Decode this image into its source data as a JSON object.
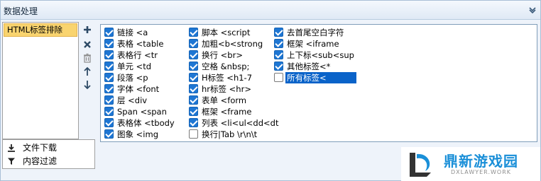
{
  "panel": {
    "title": "数据处理"
  },
  "left_list": {
    "items": [
      "HTML标签排除"
    ]
  },
  "side_tools": [
    "add-icon",
    "delete-icon",
    "trash-icon",
    "move-up-icon",
    "move-down-icon"
  ],
  "bottom_items": [
    {
      "label": "文件下载",
      "icon": "download-icon"
    },
    {
      "label": "内容过滤",
      "icon": "filter-icon"
    }
  ],
  "columns": [
    [
      {
        "label": "链接 <a",
        "checked": true
      },
      {
        "label": "表格 <table",
        "checked": true
      },
      {
        "label": "表格行 <tr",
        "checked": true
      },
      {
        "label": "单元 <td",
        "checked": true
      },
      {
        "label": "段落 <p",
        "checked": true
      },
      {
        "label": "字体 <font",
        "checked": true
      },
      {
        "label": "层 <div",
        "checked": true
      },
      {
        "label": "Span <span",
        "checked": true
      },
      {
        "label": "表格体 <tbody",
        "checked": true
      },
      {
        "label": "图象 <img",
        "checked": true
      }
    ],
    [
      {
        "label": "脚本 <script",
        "checked": true
      },
      {
        "label": "加粗<b<strong",
        "checked": true
      },
      {
        "label": "换行 <br>",
        "checked": true
      },
      {
        "label": "空格 &nbsp;",
        "checked": true
      },
      {
        "label": "H标签 <h1-7",
        "checked": true
      },
      {
        "label": "hr标签 <hr>",
        "checked": true
      },
      {
        "label": "表单 <form",
        "checked": true
      },
      {
        "label": "框架 <frame",
        "checked": true
      },
      {
        "label": "列表 <li<ul<dd<dt",
        "checked": true
      },
      {
        "label": "换行|Tab \\r\\n\\t",
        "checked": false
      }
    ],
    [
      {
        "label": "去首尾空白字符",
        "checked": true
      },
      {
        "label": "框架 <iframe",
        "checked": true
      },
      {
        "label": "上下标<sub<sup",
        "checked": true
      },
      {
        "label": "其他标签<*",
        "checked": true
      },
      {
        "label": "所有标签<",
        "checked": false,
        "highlight": true
      }
    ]
  ],
  "watermark": {
    "title": "鼎新游戏园",
    "subtitle": "DXLAWYER.WORK"
  },
  "colors": {
    "accent": "#1e76d3",
    "selection": "#0a63c9",
    "list_selected": "#f9d46f"
  }
}
